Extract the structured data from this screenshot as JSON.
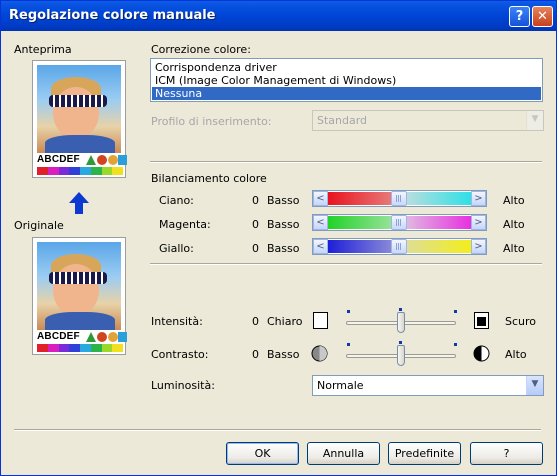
{
  "window": {
    "title": "Regolazione colore manuale",
    "help_glyph": "?",
    "close_glyph": "✕"
  },
  "preview": {
    "anteprima_label": "Anteprima",
    "originale_label": "Originale",
    "card_text": "ABCDEF",
    "swatch_colors": [
      "#e0202a",
      "#d81fbd",
      "#7a2ad8",
      "#2f3fd8",
      "#2aa8e0",
      "#2ab44a",
      "#9ad82a",
      "#f0e020"
    ]
  },
  "correction": {
    "label": "Correzione colore:",
    "options": [
      "Corrispondenza driver",
      "ICM (Image Color Management di Windows)",
      "Nessuna"
    ],
    "selected_index": 2
  },
  "profile": {
    "label": "Profilo di inserimento:",
    "value": "Standard",
    "enabled": false
  },
  "balance": {
    "label": "Bilanciamento colore",
    "rows": [
      {
        "name": "Ciano:",
        "value": "0",
        "low": "Basso",
        "high": "Alto",
        "level": 0.5
      },
      {
        "name": "Magenta:",
        "value": "0",
        "low": "Basso",
        "high": "Alto",
        "level": 0.5
      },
      {
        "name": "Giallo:",
        "value": "0",
        "low": "Basso",
        "high": "Alto",
        "level": 0.5
      }
    ]
  },
  "intensity": {
    "label": "Intensità:",
    "value": "0",
    "low": "Chiaro",
    "high": "Scuro",
    "level": 0.5
  },
  "contrast": {
    "label": "Contrasto:",
    "value": "0",
    "low": "Basso",
    "high": "Alto",
    "level": 0.5
  },
  "brightness": {
    "label": "Luminosità:",
    "value": "Normale"
  },
  "buttons": {
    "ok": "OK",
    "cancel": "Annulla",
    "defaults": "Predefinite",
    "help": "?"
  },
  "colors": {
    "title_blue": "#0046d8",
    "selection": "#316ac5",
    "dialog_bg": "#ece9d8"
  }
}
